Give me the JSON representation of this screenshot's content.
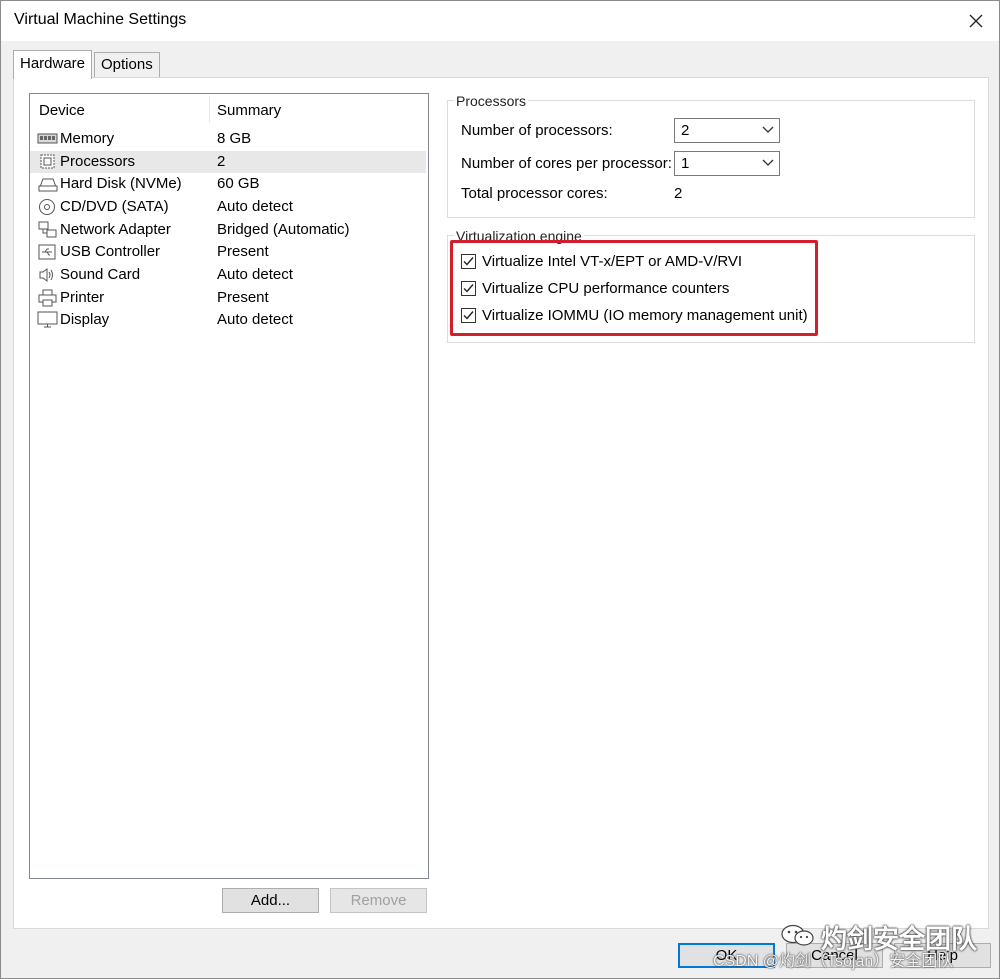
{
  "window": {
    "title": "Virtual Machine Settings"
  },
  "tabs": [
    "Hardware",
    "Options"
  ],
  "device_list": {
    "columns": [
      "Device",
      "Summary"
    ],
    "rows": [
      {
        "name": "Memory",
        "summary": "8 GB",
        "icon": "memory-icon"
      },
      {
        "name": "Processors",
        "summary": "2",
        "icon": "processor-icon"
      },
      {
        "name": "Hard Disk (NVMe)",
        "summary": "60 GB",
        "icon": "hard-disk-icon"
      },
      {
        "name": "CD/DVD (SATA)",
        "summary": "Auto detect",
        "icon": "cd-dvd-icon"
      },
      {
        "name": "Network Adapter",
        "summary": "Bridged (Automatic)",
        "icon": "network-adapter-icon"
      },
      {
        "name": "USB Controller",
        "summary": "Present",
        "icon": "usb-icon"
      },
      {
        "name": "Sound Card",
        "summary": "Auto detect",
        "icon": "speaker-icon"
      },
      {
        "name": "Printer",
        "summary": "Present",
        "icon": "printer-icon"
      },
      {
        "name": "Display",
        "summary": "Auto detect",
        "icon": "monitor-icon"
      }
    ],
    "selected": "Processors",
    "add_label": "Add...",
    "remove_label": "Remove"
  },
  "processors": {
    "group_label": "Processors",
    "num_processors_label": "Number of processors:",
    "num_processors_value": "2",
    "cores_label": "Number of cores per processor:",
    "cores_value": "1",
    "total_label": "Total processor cores:",
    "total_value": "2"
  },
  "virtualization": {
    "group_label": "Virtualization engine",
    "options": [
      {
        "label": "Virtualize Intel VT-x/EPT or AMD-V/RVI",
        "checked": true
      },
      {
        "label": "Virtualize CPU performance counters",
        "checked": true
      },
      {
        "label": "Virtualize IOMMU (IO memory management unit)",
        "checked": true
      }
    ]
  },
  "footer": {
    "ok_label": "OK",
    "cancel_label": "Cancel",
    "help_label": "Help"
  },
  "watermark": {
    "big": "灼剑安全团队",
    "small": "CSDN @灼剑（Tsojan）安全团队"
  },
  "colors": {
    "highlight": "#d0202e",
    "focus": "#0078d7"
  }
}
